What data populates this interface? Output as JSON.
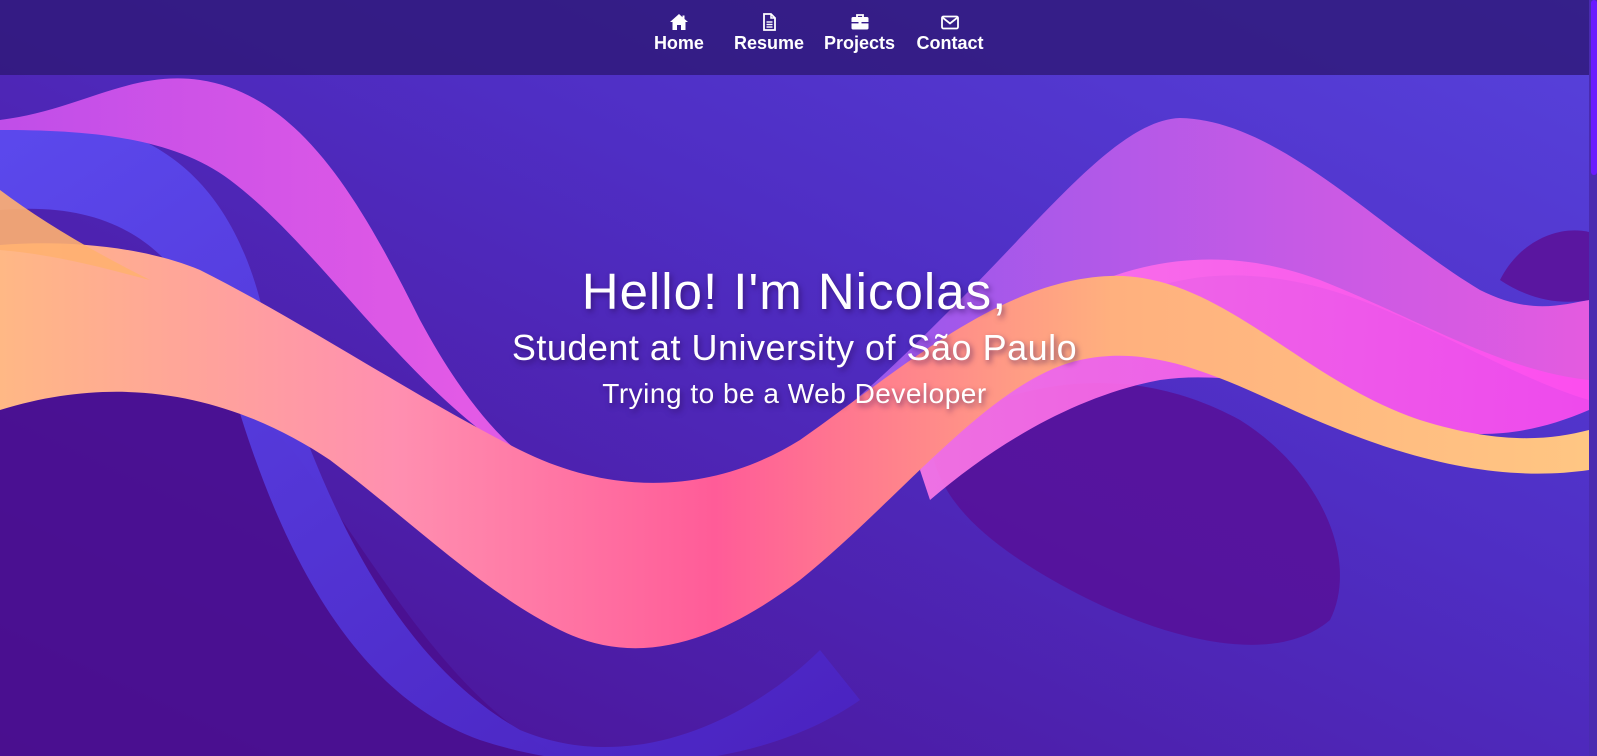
{
  "nav": {
    "items": [
      {
        "label": "Home",
        "icon": "home-icon"
      },
      {
        "label": "Resume",
        "icon": "document-icon"
      },
      {
        "label": "Projects",
        "icon": "briefcase-icon"
      },
      {
        "label": "Contact",
        "icon": "envelope-icon"
      }
    ]
  },
  "hero": {
    "greeting": "Hello! I'm Nicolas,",
    "subtitle": "Student at University of São Paulo",
    "tagline": "Trying to be a Web Developer"
  },
  "colors": {
    "background": "#4c1a9e",
    "navbar": "#2e1878",
    "wave_pink": "#ff5fe0",
    "wave_orange": "#ffb86b",
    "wave_blue": "#5a5ff0",
    "scroll_thumb": "#6a1bff"
  }
}
